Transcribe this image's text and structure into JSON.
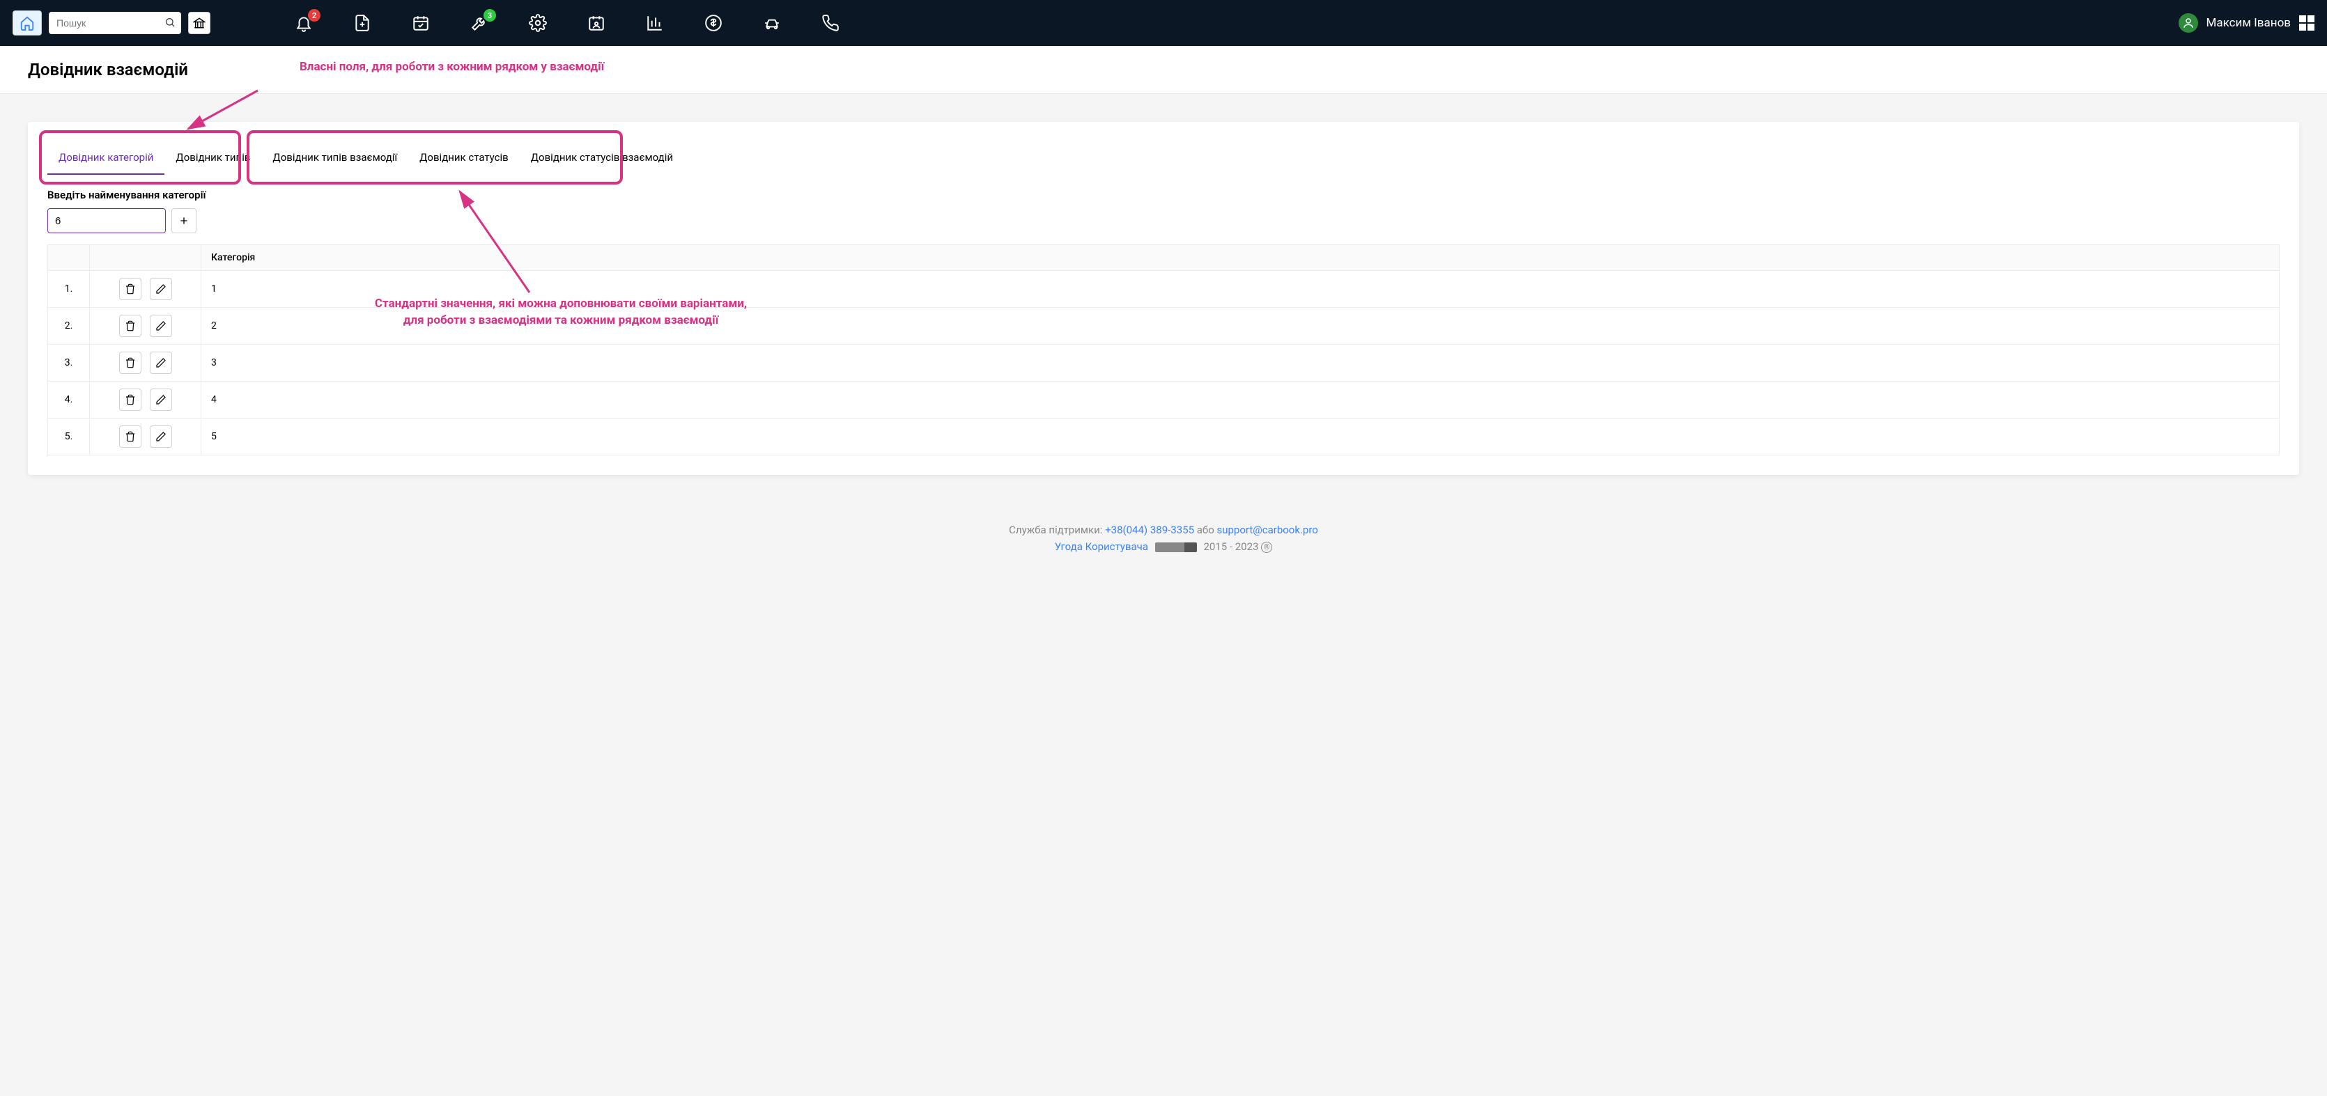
{
  "search_placeholder": "Пошук",
  "bell_badge": "2",
  "wrench_badge": "3",
  "user_name": "Максим Іванов",
  "page_title": "Довідник взаємодій",
  "annotation_top": "Власні поля, для роботи з кожним рядком у взаємодії",
  "annotation_mid_line1": "Стандартні значення, які можна доповнювати своїми варіантами,",
  "annotation_mid_line2": "для роботи з взаємодіями та кожним рядком взаємодії",
  "tabs": {
    "t1": "Довідник категорій",
    "t2": "Довідник типів",
    "t3": "Довідник типів взаємодії",
    "t4": "Довідник статусів",
    "t5": "Довідник статусів взаємодій"
  },
  "form_label": "Введіть найменування категорії",
  "form_value": "6",
  "col_header": "Категорія",
  "rows": [
    {
      "num": "1.",
      "val": "1"
    },
    {
      "num": "2.",
      "val": "2"
    },
    {
      "num": "3.",
      "val": "3"
    },
    {
      "num": "4.",
      "val": "4"
    },
    {
      "num": "5.",
      "val": "5"
    }
  ],
  "footer": {
    "support_label": "Служба підтримки: ",
    "phone": "+38(044) 389-3355",
    "or": " або ",
    "email": "support@carbook.pro",
    "agreement": "Угода Користувача",
    "years": "2015 - 2023",
    "reg": "®"
  }
}
